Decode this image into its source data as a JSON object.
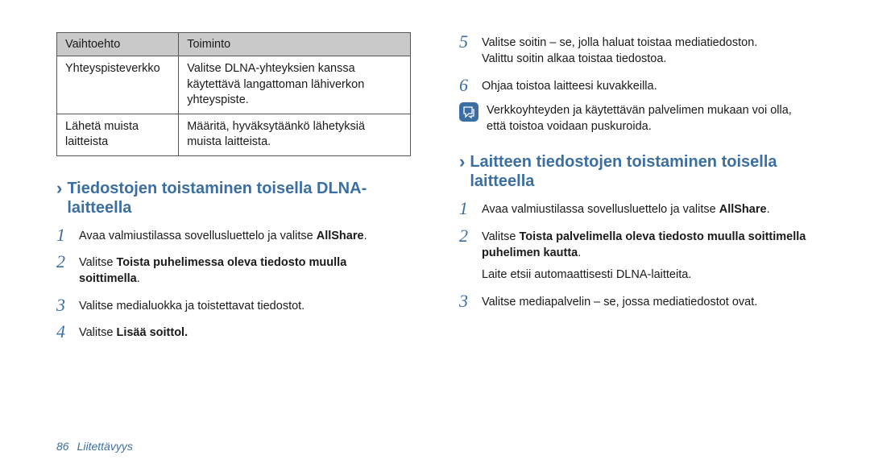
{
  "table": {
    "headers": {
      "option": "Vaihtoehto",
      "function": "Toiminto"
    },
    "rows": [
      {
        "option": "Yhteyspisteverkko",
        "function": "Valitse DLNA-yhteyksien kanssa käytettävä langattoman lähiverkon yhteyspiste."
      },
      {
        "option": "Lähetä muista laitteista",
        "function": "Määritä, hyväksytäänkö lähetyksiä muista laitteista."
      }
    ]
  },
  "left_section": {
    "title": "Tiedostojen toistaminen toisella DLNA-laitteella",
    "step1_a": "Avaa valmiustilassa sovellusluettelo ja valitse ",
    "step1_b": "AllShare",
    "step1_c": ".",
    "step2_a": "Valitse ",
    "step2_b": "Toista puhelimessa oleva tiedosto muulla soittimella",
    "step2_c": ".",
    "step3": "Valitse medialuokka ja toistettavat tiedostot.",
    "step4_a": "Valitse ",
    "step4_b": "Lisää soittol.",
    "chevron": "›"
  },
  "right_steps": {
    "step5_line1": "Valitse soitin – se, jolla haluat toistaa mediatiedoston.",
    "step5_line2": "Valittu soitin alkaa toistaa tiedostoa.",
    "step6": "Ohjaa toistoa laitteesi kuvakkeilla.",
    "note": "Verkkoyhteyden ja käytettävän palvelimen mukaan voi olla, että toistoa voidaan puskuroida."
  },
  "right_section": {
    "title": "Laitteen tiedostojen toistaminen toisella laitteella",
    "step1_a": "Avaa valmiustilassa sovellusluettelo ja valitse ",
    "step1_b": "AllShare",
    "step1_c": ".",
    "step2_a": "Valitse ",
    "step2_b": "Toista palvelimella oleva tiedosto muulla soittimella puhelimen kautta",
    "step2_c": ".",
    "step2_extra": "Laite etsii automaattisesti DLNA-laitteita.",
    "step3": "Valitse mediapalvelin – se, jossa mediatiedostot ovat.",
    "chevron": "›"
  },
  "footer": {
    "page": "86",
    "section": "Liitettävyys"
  }
}
